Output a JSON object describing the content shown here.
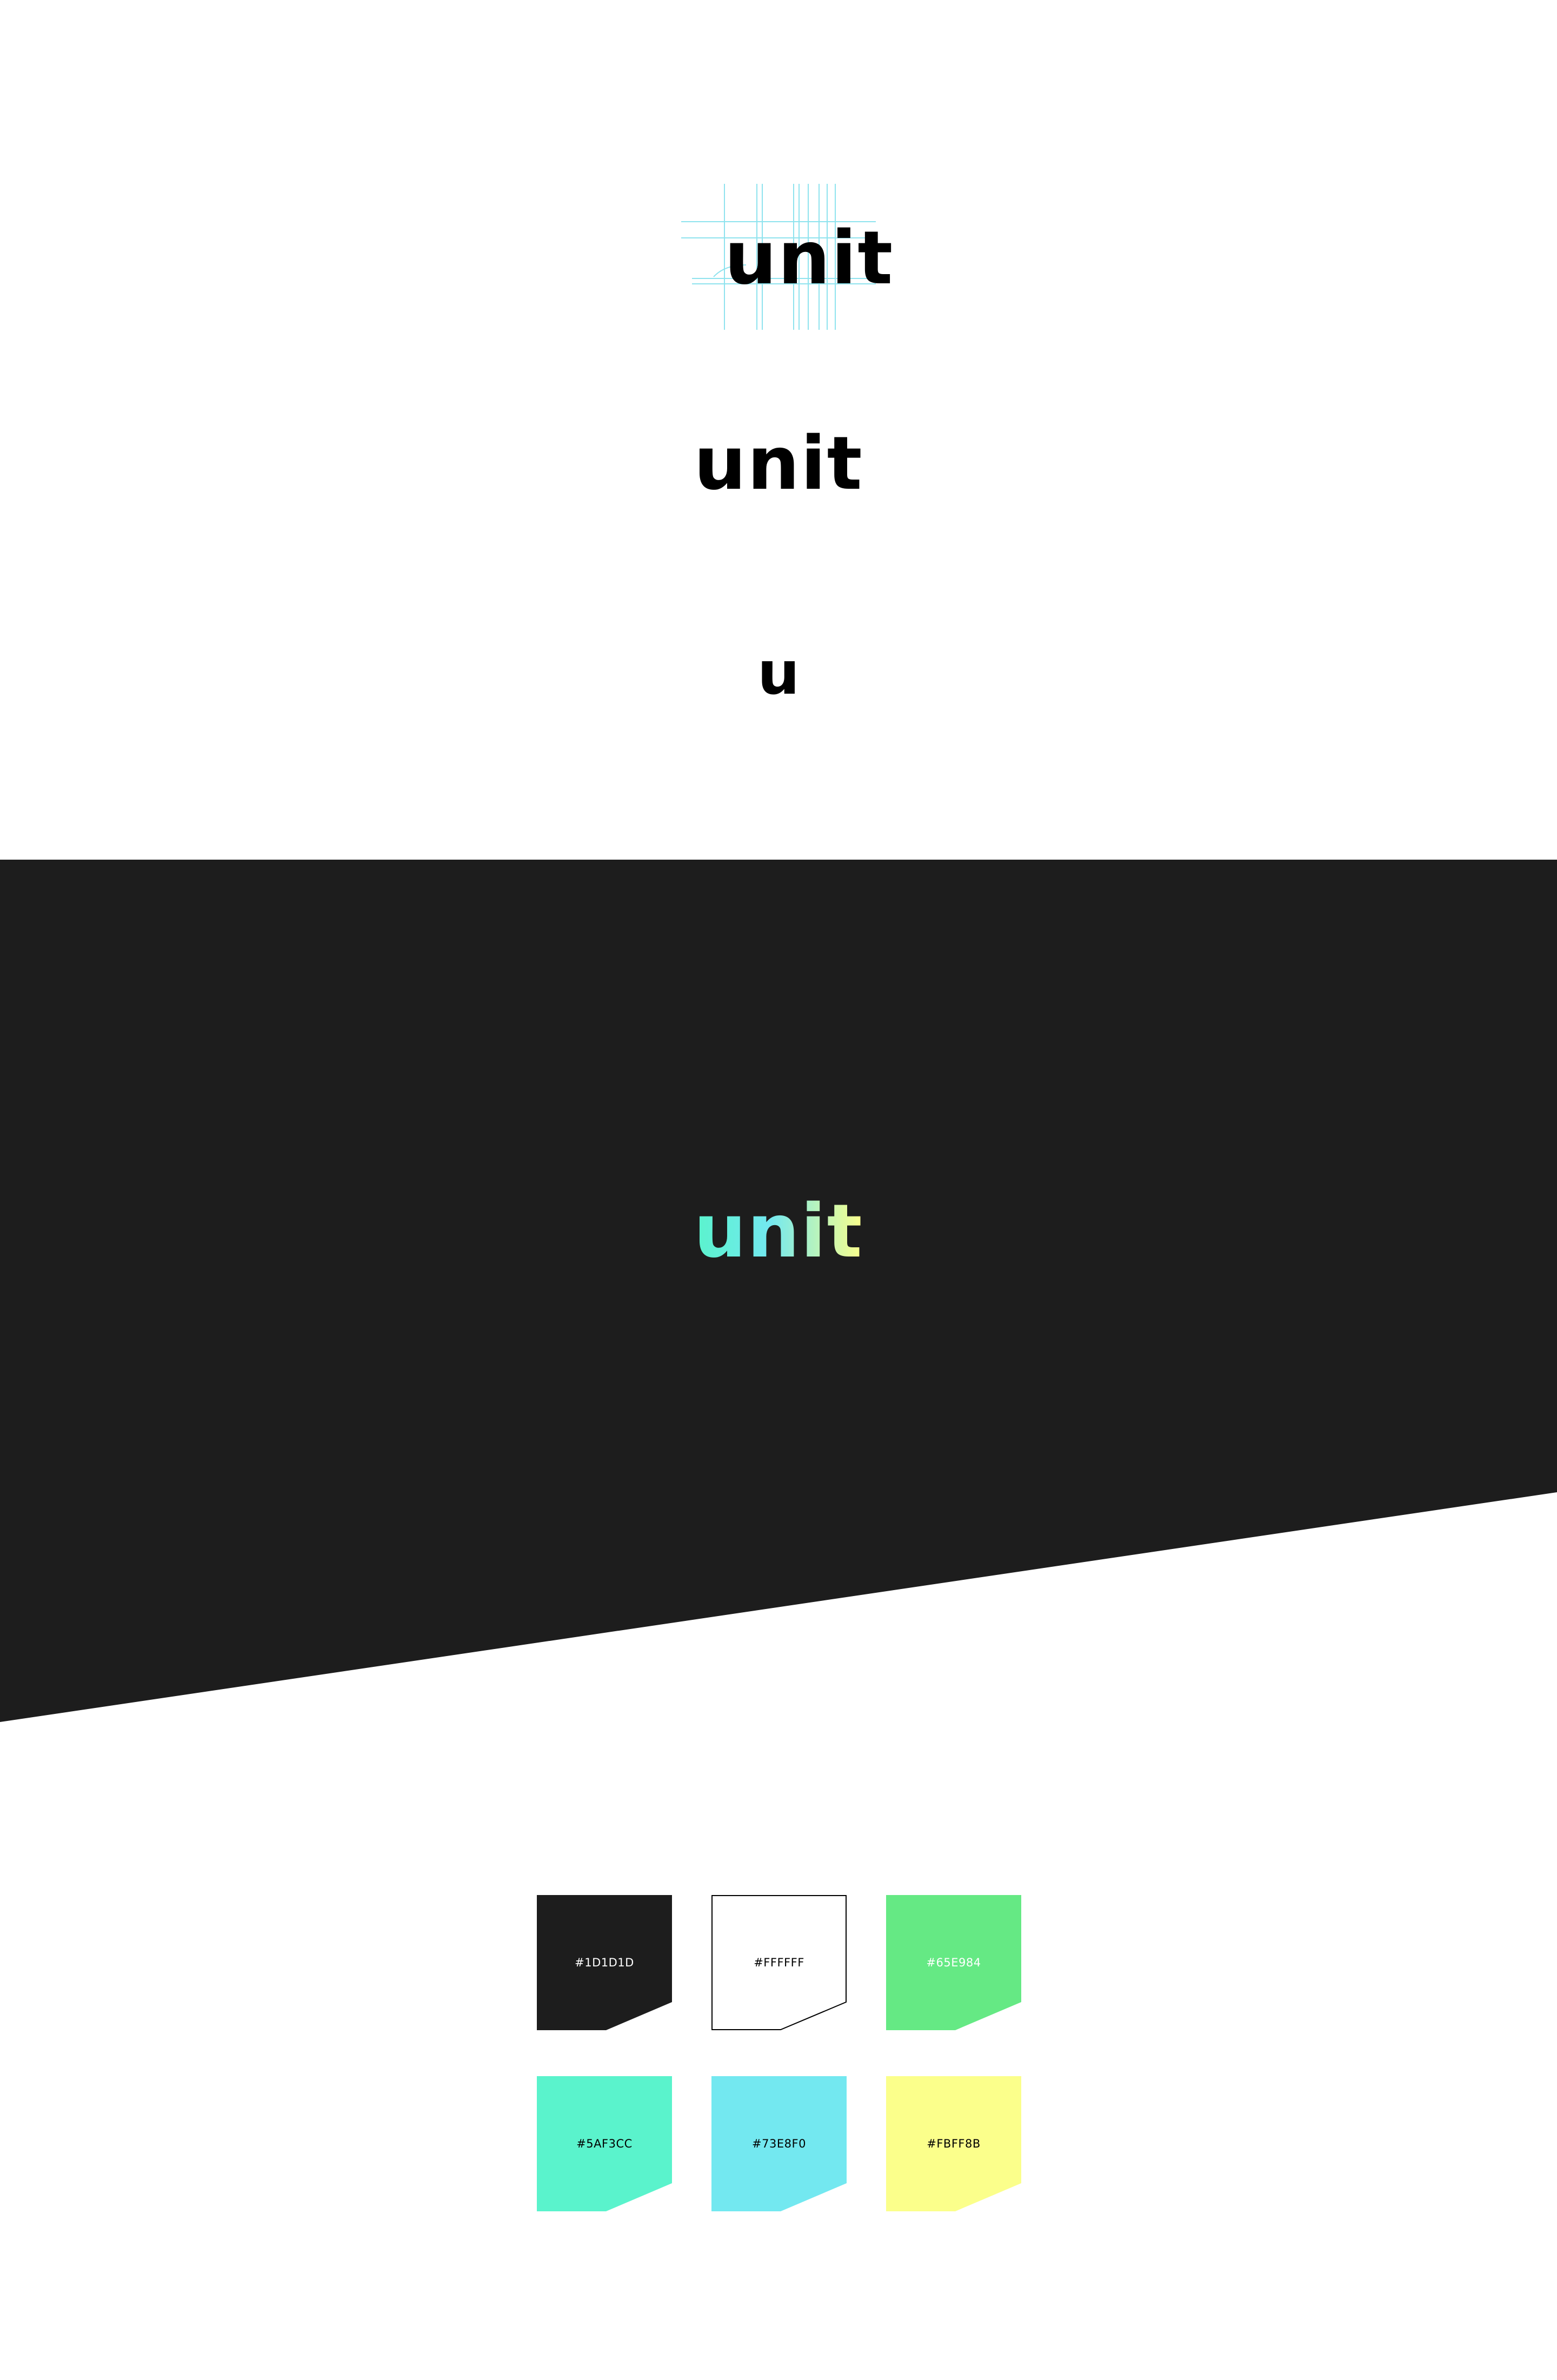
{
  "brand": {
    "wordmark": "unit",
    "monogram": "u"
  },
  "colors": {
    "dark_band": "#1D1D1D",
    "construction_lines": "#8FE3EE",
    "reverse_gradient": [
      "#5AF3CC",
      "#73E8F0",
      "#FBFF8B"
    ]
  },
  "palette": [
    {
      "hex": "#1D1D1D",
      "fill": "#1D1D1D",
      "text_color": "#ffffff",
      "outlined": false
    },
    {
      "hex": "#FFFFFF",
      "fill": "#FFFFFF",
      "text_color": "#000000",
      "outlined": true
    },
    {
      "hex": "#65E984",
      "fill": "#65E984",
      "text_color": "#ffffff",
      "outlined": false
    },
    {
      "hex": "#5AF3CC",
      "fill": "#5AF3CC",
      "text_color": "#000000",
      "outlined": false
    },
    {
      "hex": "#73E8F0",
      "fill": "#73E8F0",
      "text_color": "#000000",
      "outlined": false
    },
    {
      "hex": "#FBFF8B",
      "fill": "#FBFF8B",
      "text_color": "#000000",
      "outlined": false
    }
  ]
}
